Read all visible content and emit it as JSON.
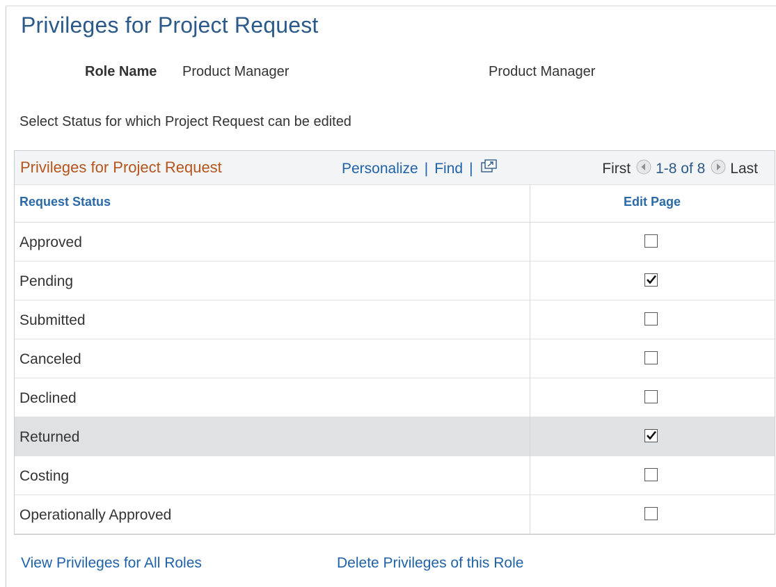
{
  "page": {
    "title": "Privileges for Project Request"
  },
  "role": {
    "label": "Role Name",
    "value": "Product Manager",
    "description": "Product Manager"
  },
  "instruction": "Select Status for which Project Request can be edited",
  "grid": {
    "title": "Privileges for Project Request",
    "personalize_label": "Personalize",
    "find_label": "Find",
    "separator": "|",
    "popout_icon": "popout-icon",
    "pager": {
      "first_label": "First",
      "count": "1-8 of 8",
      "last_label": "Last",
      "prev_icon": "previous-arrow-icon",
      "next_icon": "next-arrow-icon"
    },
    "columns": {
      "status": "Request Status",
      "edit": "Edit Page"
    },
    "rows": [
      {
        "status": "Approved",
        "edit": false
      },
      {
        "status": "Pending",
        "edit": true
      },
      {
        "status": "Submitted",
        "edit": false
      },
      {
        "status": "Canceled",
        "edit": false
      },
      {
        "status": "Declined",
        "edit": false
      },
      {
        "status": "Returned",
        "edit": true,
        "highlighted": true
      },
      {
        "status": "Costing",
        "edit": false
      },
      {
        "status": "Operationally Approved",
        "edit": false
      }
    ]
  },
  "links": {
    "view_all": "View Privileges for All Roles",
    "delete_role": "Delete Privileges of this Role"
  },
  "colors": {
    "title": "#2b5a8a",
    "grid_title": "#b5541b",
    "link": "#1f62a8",
    "highlight_row": "#dfe1e2"
  }
}
